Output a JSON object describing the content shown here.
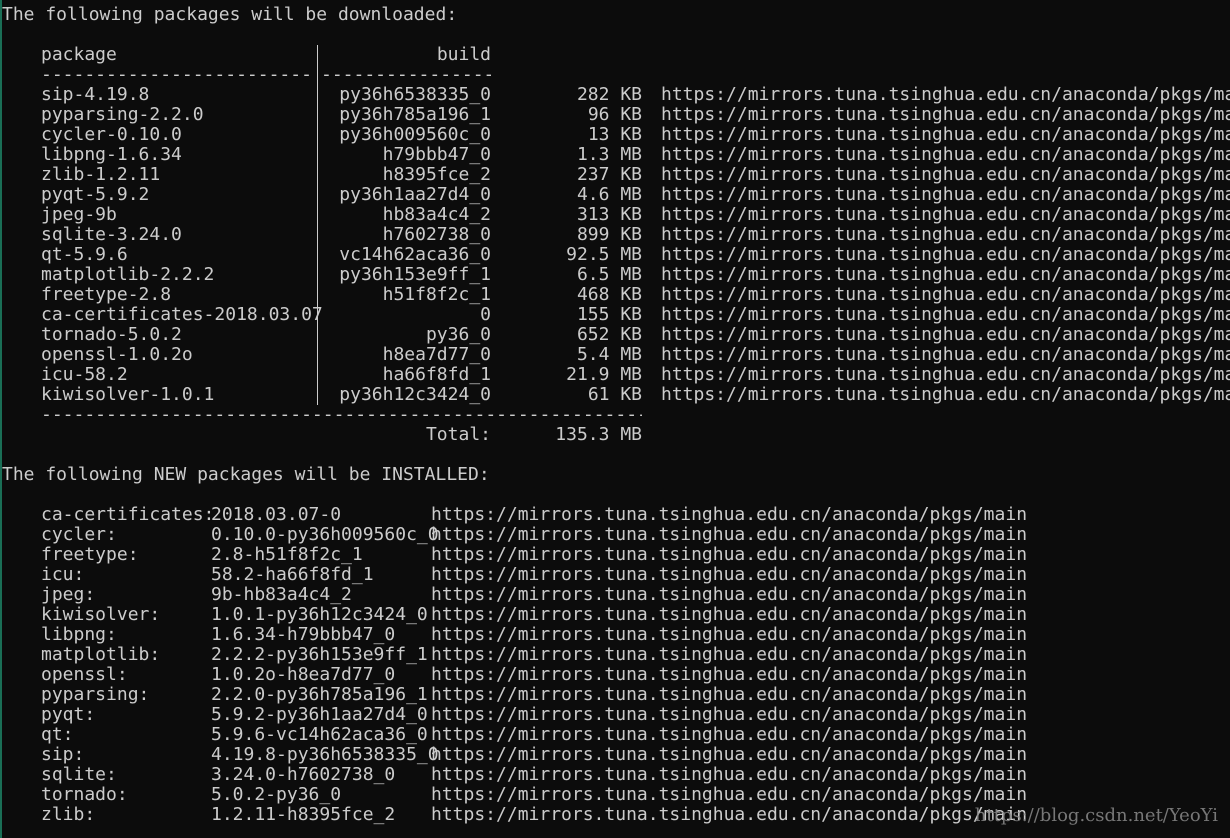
{
  "header_download": "The following packages will be downloaded:",
  "download_table": {
    "col_package": "package",
    "col_build": "build",
    "dash_package": "---------------------------",
    "dash_build": "-----------------",
    "rows": [
      {
        "package": "sip-4.19.8",
        "build": "py36h6538335_0",
        "size": "282 KB",
        "channel": "https://mirrors.tuna.tsinghua.edu.cn/anaconda/pkgs/main"
      },
      {
        "package": "pyparsing-2.2.0",
        "build": "py36h785a196_1",
        "size": "96 KB",
        "channel": "https://mirrors.tuna.tsinghua.edu.cn/anaconda/pkgs/main"
      },
      {
        "package": "cycler-0.10.0",
        "build": "py36h009560c_0",
        "size": "13 KB",
        "channel": "https://mirrors.tuna.tsinghua.edu.cn/anaconda/pkgs/main"
      },
      {
        "package": "libpng-1.6.34",
        "build": "h79bbb47_0",
        "size": "1.3 MB",
        "channel": "https://mirrors.tuna.tsinghua.edu.cn/anaconda/pkgs/main"
      },
      {
        "package": "zlib-1.2.11",
        "build": "h8395fce_2",
        "size": "237 KB",
        "channel": "https://mirrors.tuna.tsinghua.edu.cn/anaconda/pkgs/main"
      },
      {
        "package": "pyqt-5.9.2",
        "build": "py36h1aa27d4_0",
        "size": "4.6 MB",
        "channel": "https://mirrors.tuna.tsinghua.edu.cn/anaconda/pkgs/main"
      },
      {
        "package": "jpeg-9b",
        "build": "hb83a4c4_2",
        "size": "313 KB",
        "channel": "https://mirrors.tuna.tsinghua.edu.cn/anaconda/pkgs/main"
      },
      {
        "package": "sqlite-3.24.0",
        "build": "h7602738_0",
        "size": "899 KB",
        "channel": "https://mirrors.tuna.tsinghua.edu.cn/anaconda/pkgs/main"
      },
      {
        "package": "qt-5.9.6",
        "build": "vc14h62aca36_0",
        "size": "92.5 MB",
        "channel": "https://mirrors.tuna.tsinghua.edu.cn/anaconda/pkgs/main"
      },
      {
        "package": "matplotlib-2.2.2",
        "build": "py36h153e9ff_1",
        "size": "6.5 MB",
        "channel": "https://mirrors.tuna.tsinghua.edu.cn/anaconda/pkgs/main"
      },
      {
        "package": "freetype-2.8",
        "build": "h51f8f2c_1",
        "size": "468 KB",
        "channel": "https://mirrors.tuna.tsinghua.edu.cn/anaconda/pkgs/main"
      },
      {
        "package": "ca-certificates-2018.03.07",
        "build": "0",
        "size": "155 KB",
        "channel": "https://mirrors.tuna.tsinghua.edu.cn/anaconda/pkgs/main"
      },
      {
        "package": "tornado-5.0.2",
        "build": "py36_0",
        "size": "652 KB",
        "channel": "https://mirrors.tuna.tsinghua.edu.cn/anaconda/pkgs/main"
      },
      {
        "package": "openssl-1.0.2o",
        "build": "h8ea7d77_0",
        "size": "5.4 MB",
        "channel": "https://mirrors.tuna.tsinghua.edu.cn/anaconda/pkgs/main"
      },
      {
        "package": "icu-58.2",
        "build": "ha66f8fd_1",
        "size": "21.9 MB",
        "channel": "https://mirrors.tuna.tsinghua.edu.cn/anaconda/pkgs/main"
      },
      {
        "package": "kiwisolver-1.0.1",
        "build": "py36h12c3424_0",
        "size": "61 KB",
        "channel": "https://mirrors.tuna.tsinghua.edu.cn/anaconda/pkgs/main"
      }
    ],
    "dash_total": "------------------------------------------------------------",
    "total_label": "Total:",
    "total_value": "135.3 MB"
  },
  "header_install": "The following NEW packages will be INSTALLED:",
  "install_list": [
    {
      "name": "ca-certificates:",
      "version": "2018.03.07-0",
      "channel": "https://mirrors.tuna.tsinghua.edu.cn/anaconda/pkgs/main"
    },
    {
      "name": "cycler:",
      "version": "0.10.0-py36h009560c_0",
      "channel": "https://mirrors.tuna.tsinghua.edu.cn/anaconda/pkgs/main"
    },
    {
      "name": "freetype:",
      "version": "2.8-h51f8f2c_1",
      "channel": "https://mirrors.tuna.tsinghua.edu.cn/anaconda/pkgs/main"
    },
    {
      "name": "icu:",
      "version": "58.2-ha66f8fd_1",
      "channel": "https://mirrors.tuna.tsinghua.edu.cn/anaconda/pkgs/main"
    },
    {
      "name": "jpeg:",
      "version": "9b-hb83a4c4_2",
      "channel": "https://mirrors.tuna.tsinghua.edu.cn/anaconda/pkgs/main"
    },
    {
      "name": "kiwisolver:",
      "version": "1.0.1-py36h12c3424_0",
      "channel": "https://mirrors.tuna.tsinghua.edu.cn/anaconda/pkgs/main"
    },
    {
      "name": "libpng:",
      "version": "1.6.34-h79bbb47_0",
      "channel": "https://mirrors.tuna.tsinghua.edu.cn/anaconda/pkgs/main"
    },
    {
      "name": "matplotlib:",
      "version": "2.2.2-py36h153e9ff_1",
      "channel": "https://mirrors.tuna.tsinghua.edu.cn/anaconda/pkgs/main"
    },
    {
      "name": "openssl:",
      "version": "1.0.2o-h8ea7d77_0",
      "channel": "https://mirrors.tuna.tsinghua.edu.cn/anaconda/pkgs/main"
    },
    {
      "name": "pyparsing:",
      "version": "2.2.0-py36h785a196_1",
      "channel": "https://mirrors.tuna.tsinghua.edu.cn/anaconda/pkgs/main"
    },
    {
      "name": "pyqt:",
      "version": "5.9.2-py36h1aa27d4_0",
      "channel": "https://mirrors.tuna.tsinghua.edu.cn/anaconda/pkgs/main"
    },
    {
      "name": "qt:",
      "version": "5.9.6-vc14h62aca36_0",
      "channel": "https://mirrors.tuna.tsinghua.edu.cn/anaconda/pkgs/main"
    },
    {
      "name": "sip:",
      "version": "4.19.8-py36h6538335_0",
      "channel": "https://mirrors.tuna.tsinghua.edu.cn/anaconda/pkgs/main"
    },
    {
      "name": "sqlite:",
      "version": "3.24.0-h7602738_0",
      "channel": "https://mirrors.tuna.tsinghua.edu.cn/anaconda/pkgs/main"
    },
    {
      "name": "tornado:",
      "version": "5.0.2-py36_0",
      "channel": "https://mirrors.tuna.tsinghua.edu.cn/anaconda/pkgs/main"
    },
    {
      "name": "zlib:",
      "version": "1.2.11-h8395fce_2",
      "channel": "https://mirrors.tuna.tsinghua.edu.cn/anaconda/pkgs/main"
    }
  ],
  "watermark": "https://blog.csdn.net/YeoYi",
  "colors": {
    "background": "#0c0c0c",
    "text": "#cccccc",
    "accent": "#1a6f56"
  }
}
